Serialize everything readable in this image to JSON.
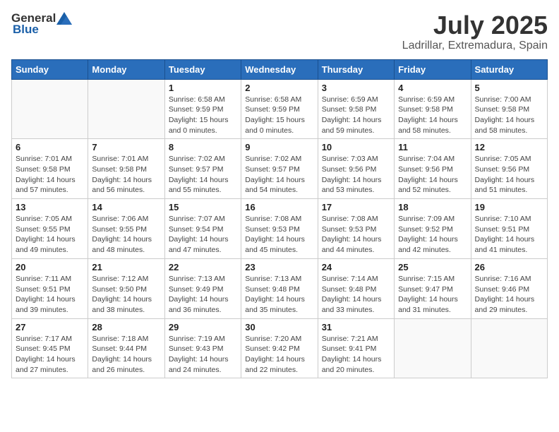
{
  "header": {
    "logo_general": "General",
    "logo_blue": "Blue",
    "title": "July 2025",
    "subtitle": "Ladrillar, Extremadura, Spain"
  },
  "calendar": {
    "days_of_week": [
      "Sunday",
      "Monday",
      "Tuesday",
      "Wednesday",
      "Thursday",
      "Friday",
      "Saturday"
    ],
    "weeks": [
      [
        {
          "day": "",
          "info": ""
        },
        {
          "day": "",
          "info": ""
        },
        {
          "day": "1",
          "info": "Sunrise: 6:58 AM\nSunset: 9:59 PM\nDaylight: 15 hours\nand 0 minutes."
        },
        {
          "day": "2",
          "info": "Sunrise: 6:58 AM\nSunset: 9:59 PM\nDaylight: 15 hours\nand 0 minutes."
        },
        {
          "day": "3",
          "info": "Sunrise: 6:59 AM\nSunset: 9:58 PM\nDaylight: 14 hours\nand 59 minutes."
        },
        {
          "day": "4",
          "info": "Sunrise: 6:59 AM\nSunset: 9:58 PM\nDaylight: 14 hours\nand 58 minutes."
        },
        {
          "day": "5",
          "info": "Sunrise: 7:00 AM\nSunset: 9:58 PM\nDaylight: 14 hours\nand 58 minutes."
        }
      ],
      [
        {
          "day": "6",
          "info": "Sunrise: 7:01 AM\nSunset: 9:58 PM\nDaylight: 14 hours\nand 57 minutes."
        },
        {
          "day": "7",
          "info": "Sunrise: 7:01 AM\nSunset: 9:58 PM\nDaylight: 14 hours\nand 56 minutes."
        },
        {
          "day": "8",
          "info": "Sunrise: 7:02 AM\nSunset: 9:57 PM\nDaylight: 14 hours\nand 55 minutes."
        },
        {
          "day": "9",
          "info": "Sunrise: 7:02 AM\nSunset: 9:57 PM\nDaylight: 14 hours\nand 54 minutes."
        },
        {
          "day": "10",
          "info": "Sunrise: 7:03 AM\nSunset: 9:56 PM\nDaylight: 14 hours\nand 53 minutes."
        },
        {
          "day": "11",
          "info": "Sunrise: 7:04 AM\nSunset: 9:56 PM\nDaylight: 14 hours\nand 52 minutes."
        },
        {
          "day": "12",
          "info": "Sunrise: 7:05 AM\nSunset: 9:56 PM\nDaylight: 14 hours\nand 51 minutes."
        }
      ],
      [
        {
          "day": "13",
          "info": "Sunrise: 7:05 AM\nSunset: 9:55 PM\nDaylight: 14 hours\nand 49 minutes."
        },
        {
          "day": "14",
          "info": "Sunrise: 7:06 AM\nSunset: 9:55 PM\nDaylight: 14 hours\nand 48 minutes."
        },
        {
          "day": "15",
          "info": "Sunrise: 7:07 AM\nSunset: 9:54 PM\nDaylight: 14 hours\nand 47 minutes."
        },
        {
          "day": "16",
          "info": "Sunrise: 7:08 AM\nSunset: 9:53 PM\nDaylight: 14 hours\nand 45 minutes."
        },
        {
          "day": "17",
          "info": "Sunrise: 7:08 AM\nSunset: 9:53 PM\nDaylight: 14 hours\nand 44 minutes."
        },
        {
          "day": "18",
          "info": "Sunrise: 7:09 AM\nSunset: 9:52 PM\nDaylight: 14 hours\nand 42 minutes."
        },
        {
          "day": "19",
          "info": "Sunrise: 7:10 AM\nSunset: 9:51 PM\nDaylight: 14 hours\nand 41 minutes."
        }
      ],
      [
        {
          "day": "20",
          "info": "Sunrise: 7:11 AM\nSunset: 9:51 PM\nDaylight: 14 hours\nand 39 minutes."
        },
        {
          "day": "21",
          "info": "Sunrise: 7:12 AM\nSunset: 9:50 PM\nDaylight: 14 hours\nand 38 minutes."
        },
        {
          "day": "22",
          "info": "Sunrise: 7:13 AM\nSunset: 9:49 PM\nDaylight: 14 hours\nand 36 minutes."
        },
        {
          "day": "23",
          "info": "Sunrise: 7:13 AM\nSunset: 9:48 PM\nDaylight: 14 hours\nand 35 minutes."
        },
        {
          "day": "24",
          "info": "Sunrise: 7:14 AM\nSunset: 9:48 PM\nDaylight: 14 hours\nand 33 minutes."
        },
        {
          "day": "25",
          "info": "Sunrise: 7:15 AM\nSunset: 9:47 PM\nDaylight: 14 hours\nand 31 minutes."
        },
        {
          "day": "26",
          "info": "Sunrise: 7:16 AM\nSunset: 9:46 PM\nDaylight: 14 hours\nand 29 minutes."
        }
      ],
      [
        {
          "day": "27",
          "info": "Sunrise: 7:17 AM\nSunset: 9:45 PM\nDaylight: 14 hours\nand 27 minutes."
        },
        {
          "day": "28",
          "info": "Sunrise: 7:18 AM\nSunset: 9:44 PM\nDaylight: 14 hours\nand 26 minutes."
        },
        {
          "day": "29",
          "info": "Sunrise: 7:19 AM\nSunset: 9:43 PM\nDaylight: 14 hours\nand 24 minutes."
        },
        {
          "day": "30",
          "info": "Sunrise: 7:20 AM\nSunset: 9:42 PM\nDaylight: 14 hours\nand 22 minutes."
        },
        {
          "day": "31",
          "info": "Sunrise: 7:21 AM\nSunset: 9:41 PM\nDaylight: 14 hours\nand 20 minutes."
        },
        {
          "day": "",
          "info": ""
        },
        {
          "day": "",
          "info": ""
        }
      ]
    ]
  }
}
